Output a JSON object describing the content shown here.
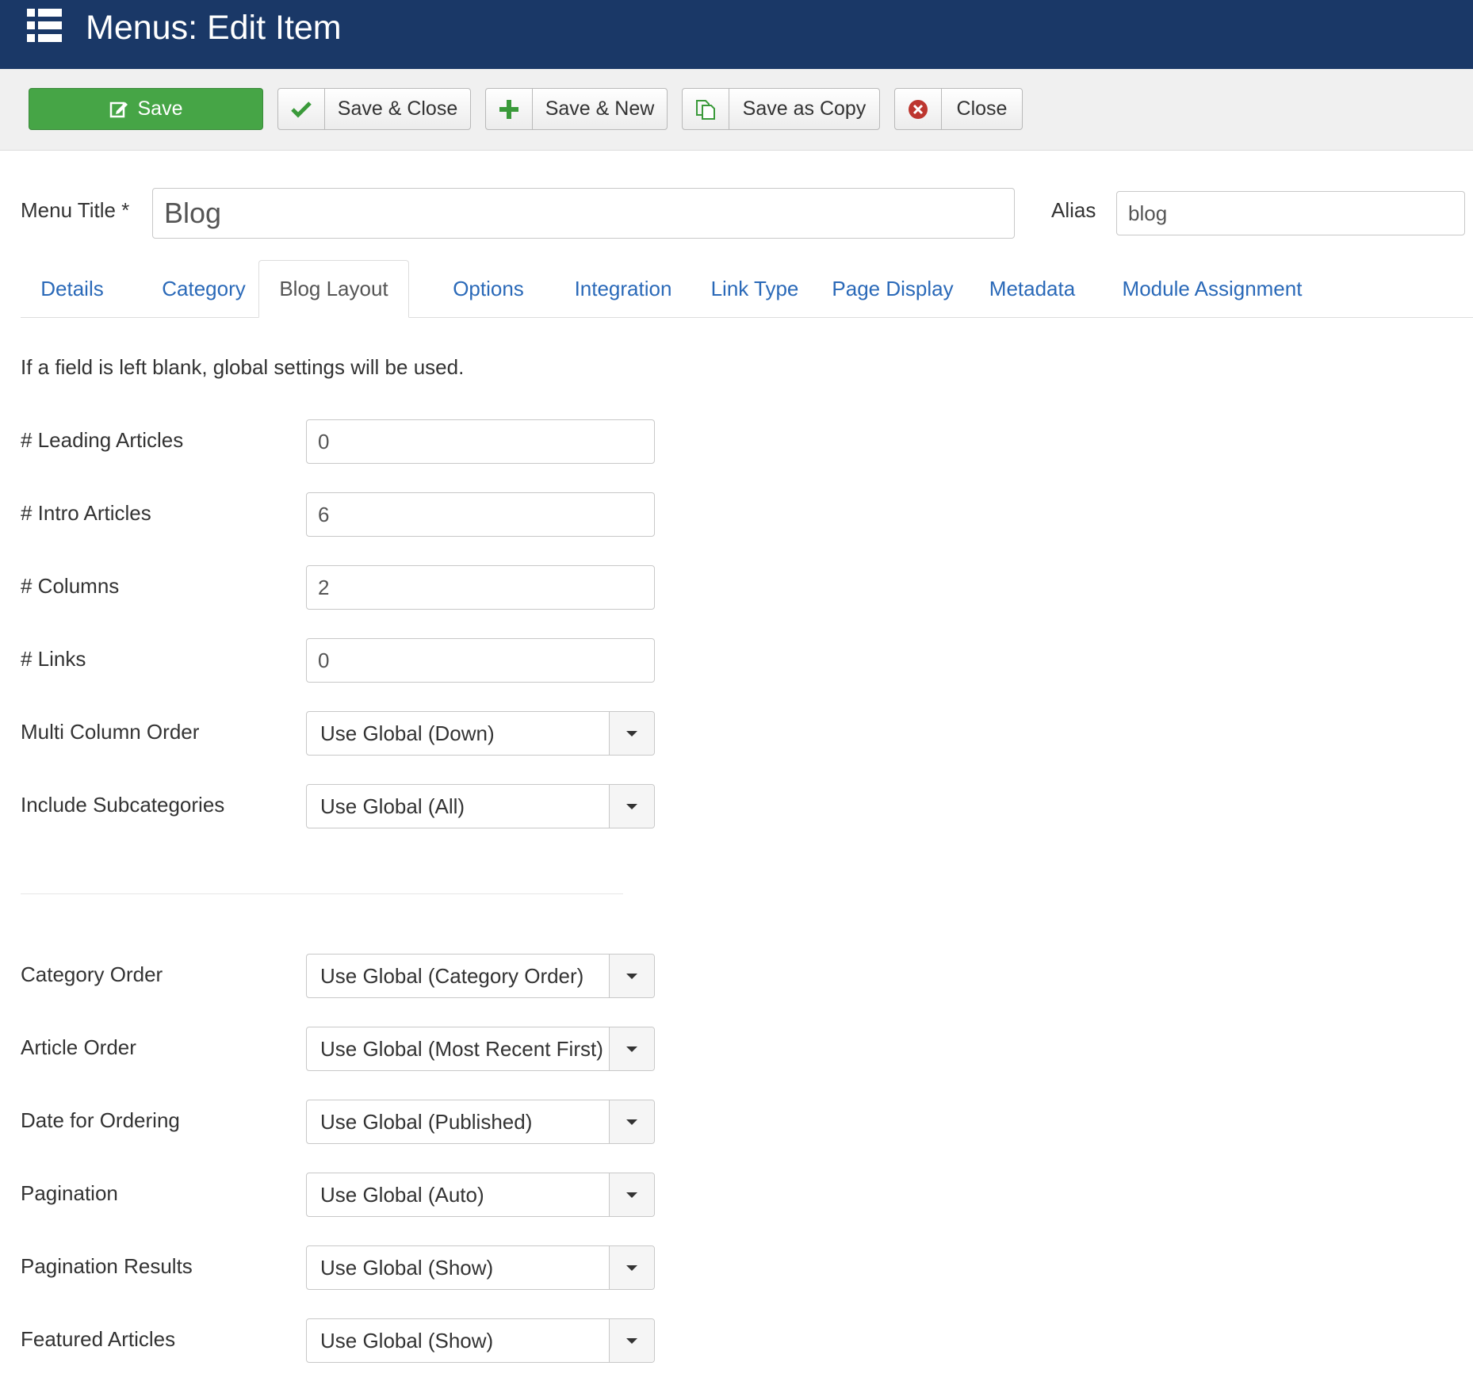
{
  "header": {
    "title": "Menus: Edit Item",
    "icon": "list-icon"
  },
  "toolbar": {
    "save_label": "Save",
    "save_close_label": "Save & Close",
    "save_new_label": "Save & New",
    "save_copy_label": "Save as Copy",
    "close_label": "Close"
  },
  "form": {
    "menu_title_label": "Menu Title *",
    "menu_title_value": "Blog",
    "alias_label": "Alias",
    "alias_value": "blog"
  },
  "tabs": [
    {
      "label": "Details"
    },
    {
      "label": "Category"
    },
    {
      "label": "Blog Layout",
      "active": true
    },
    {
      "label": "Options"
    },
    {
      "label": "Integration"
    },
    {
      "label": "Link Type"
    },
    {
      "label": "Page Display"
    },
    {
      "label": "Metadata"
    },
    {
      "label": "Module Assignment"
    }
  ],
  "blog_layout": {
    "hint": "If a field is left blank, global settings will be used.",
    "fields": [
      {
        "label": "# Leading Articles",
        "value": "0"
      },
      {
        "label": "# Intro Articles",
        "value": "6"
      },
      {
        "label": "# Columns",
        "value": "2"
      },
      {
        "label": "# Links",
        "value": "0"
      },
      {
        "label": "Multi Column Order",
        "value": "Use Global (Down)"
      },
      {
        "label": "Include Subcategories",
        "value": "Use Global (All)"
      },
      {
        "label": "Category Order",
        "value": "Use Global (Category Order)"
      },
      {
        "label": "Article Order",
        "value": "Use Global (Most Recent First)"
      },
      {
        "label": "Date for Ordering",
        "value": "Use Global (Published)"
      },
      {
        "label": "Pagination",
        "value": "Use Global (Auto)"
      },
      {
        "label": "Pagination Results",
        "value": "Use Global (Show)"
      },
      {
        "label": "Featured Articles",
        "value": "Use Global (Show)"
      }
    ]
  },
  "colors": {
    "header_bg": "#1a3867",
    "save_green": "#46a546",
    "link_blue": "#2a69b8",
    "close_red": "#bd362f"
  }
}
